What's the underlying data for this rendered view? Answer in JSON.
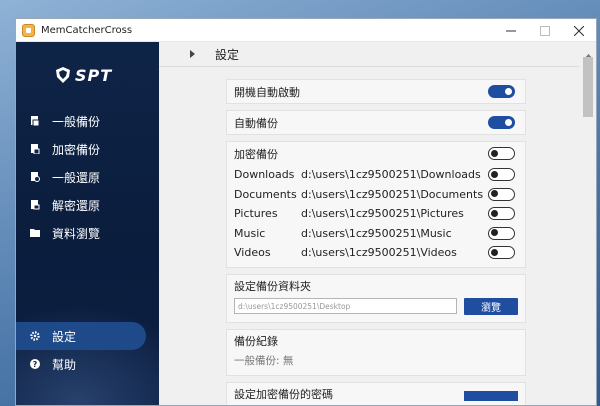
{
  "window": {
    "title": "MemCatcherCross"
  },
  "sidebar": {
    "logo_text": "SPT",
    "items": [
      {
        "label": "一般備份",
        "icon": "backup-icon"
      },
      {
        "label": "加密備份",
        "icon": "encrypted-backup-icon"
      },
      {
        "label": "一般還原",
        "icon": "restore-icon"
      },
      {
        "label": "解密還原",
        "icon": "decrypt-restore-icon"
      },
      {
        "label": "資料瀏覽",
        "icon": "browse-data-icon"
      }
    ],
    "bottom_items": [
      {
        "label": "設定",
        "icon": "gear-icon",
        "active": true
      },
      {
        "label": "幫助",
        "icon": "help-icon"
      }
    ]
  },
  "main": {
    "title": "設定",
    "auto_start": {
      "label": "開機自動啟動",
      "on": true
    },
    "auto_backup": {
      "label": "自動備份",
      "on": true
    },
    "encrypted_backup": {
      "label": "加密備份",
      "on": false,
      "folders": [
        {
          "name": "Downloads",
          "path": "d:\\users\\1cz9500251\\Downloads",
          "on": false
        },
        {
          "name": "Documents",
          "path": "d:\\users\\1cz9500251\\Documents",
          "on": false
        },
        {
          "name": "Pictures",
          "path": "d:\\users\\1cz9500251\\Pictures",
          "on": false
        },
        {
          "name": "Music",
          "path": "d:\\users\\1cz9500251\\Music",
          "on": false
        },
        {
          "name": "Videos",
          "path": "d:\\users\\1cz9500251\\Videos",
          "on": false
        }
      ]
    },
    "backup_folder": {
      "label": "設定備份資料夾",
      "value": "d:\\users\\1cz9500251\\Desktop",
      "button_label": "瀏覽"
    },
    "backup_log": {
      "label": "備份紀錄",
      "text": "一般備份: 無"
    },
    "encrypt_password": {
      "label": "設定加密備份的密碼"
    }
  },
  "colors": {
    "accent": "#1f4ea1",
    "sidebar": "#0e2447"
  }
}
